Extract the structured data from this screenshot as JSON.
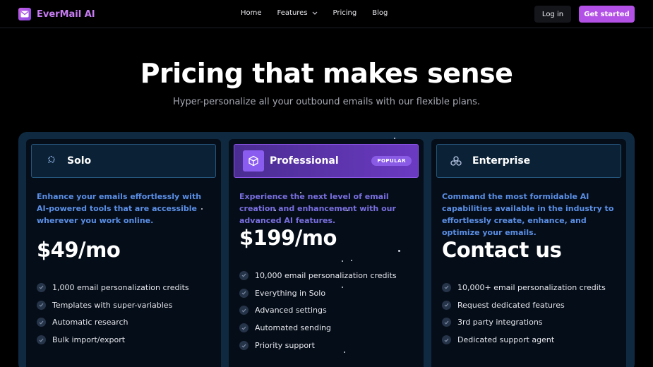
{
  "brand": {
    "name": "EverMail AI",
    "accent": "#b351e6"
  },
  "nav": {
    "links": [
      {
        "label": "Home"
      },
      {
        "label": "Features",
        "icon": "chevron-down-icon"
      },
      {
        "label": "Pricing"
      },
      {
        "label": "Blog"
      }
    ],
    "login_label": "Log in",
    "cta_label": "Get started"
  },
  "hero": {
    "title": "Pricing that makes sense",
    "subtitle": "Hyper-personalize all your outbound emails with our flexible plans."
  },
  "plans": [
    {
      "name": "Solo",
      "icon": "puzzle-icon",
      "description": "Enhance your emails effortlessly with AI-powered tools that are accessible wherever you work online.",
      "price": "$49/mo",
      "features": [
        "1,000 email personalization credits",
        "Templates with super-variables",
        "Automatic research",
        "Bulk import/export"
      ]
    },
    {
      "name": "Professional",
      "icon": "cube-icon",
      "badge": "POPULAR",
      "description": "Experience the next level of email creation and enhancement with our advanced AI features.",
      "price": "$199/mo",
      "features": [
        "10,000 email personalization credits",
        "Everything in Solo",
        "Advanced settings",
        "Automated sending",
        "Priority support"
      ]
    },
    {
      "name": "Enterprise",
      "icon": "network-icon",
      "description": "Command the most formidable AI capabilities available in the industry to effortlessly create, enhance, and optimize your emails.",
      "price": "Contact us",
      "features": [
        "10,000+ email personalization credits",
        "Request dedicated features",
        "3rd party integrations",
        "Dedicated support agent"
      ]
    }
  ]
}
